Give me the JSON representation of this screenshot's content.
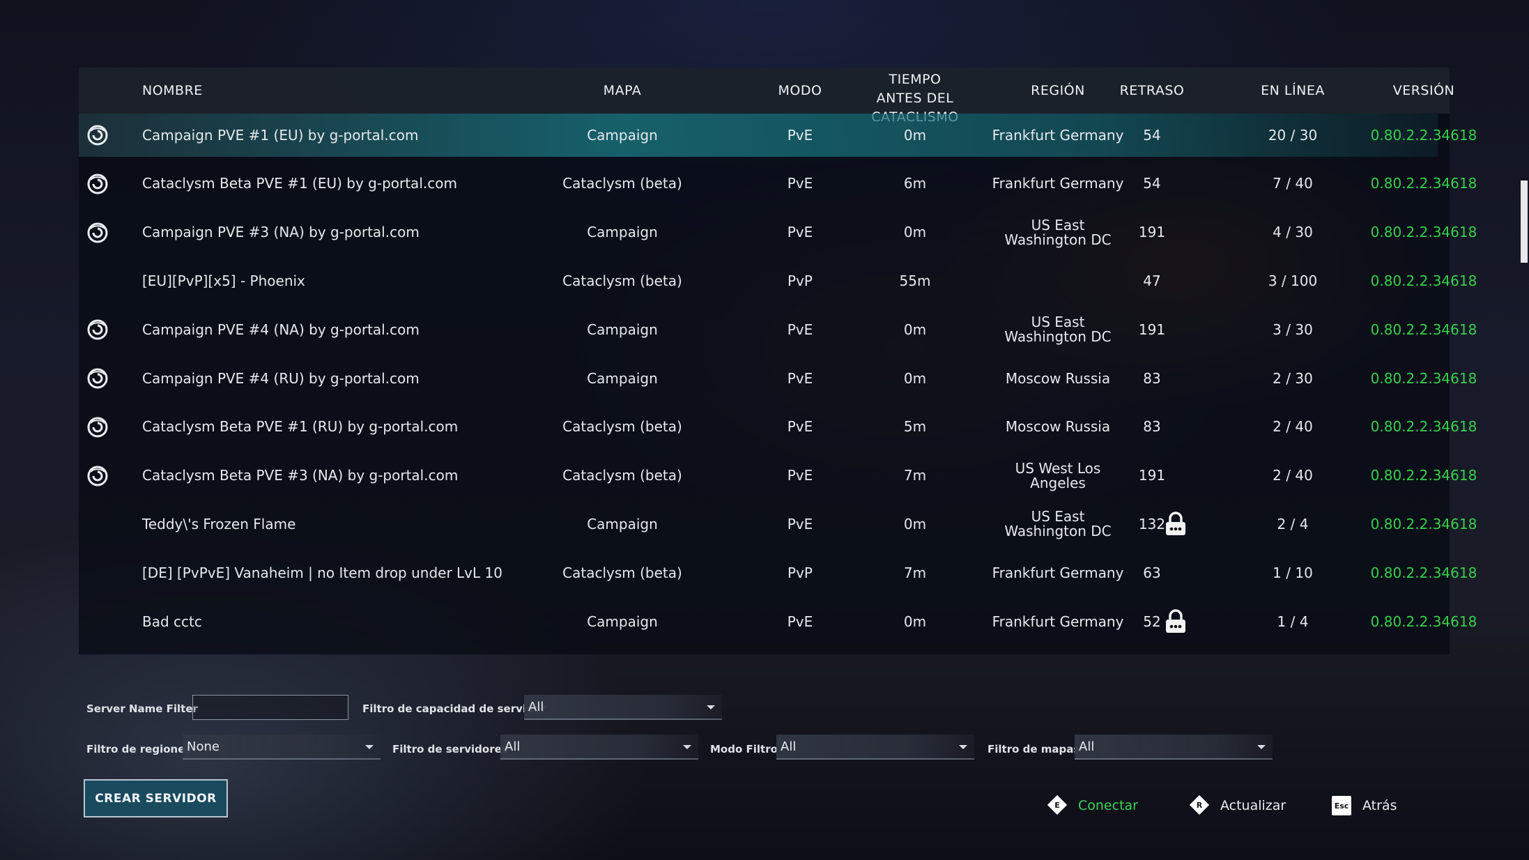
{
  "table": {
    "headers": {
      "name": "NOMBRE",
      "map": "MAPA",
      "mode": "MODO",
      "time_line1": "TIEMPO",
      "time_line2": "ANTES DEL",
      "time_line3": "CATACLISMO",
      "region": "REGIÓN",
      "ping": "RETRASO",
      "online": "EN LÍNEA",
      "version": "VERSIÓN"
    },
    "rows": [
      {
        "official": true,
        "name": "Campaign PVE #1 (EU) by g-portal.com",
        "map": "Campaign",
        "mode": "PvE",
        "time": "0m",
        "region_1": "Frankfurt Germany",
        "region_2": "",
        "ping": "54",
        "locked": false,
        "online": "20 / 30",
        "version": "0.80.2.2.34618"
      },
      {
        "official": true,
        "name": "Cataclysm Beta PVE #1 (EU) by g-portal.com",
        "map": "Cataclysm (beta)",
        "mode": "PvE",
        "time": "6m",
        "region_1": "Frankfurt Germany",
        "region_2": "",
        "ping": "54",
        "locked": false,
        "online": "7 / 40",
        "version": "0.80.2.2.34618"
      },
      {
        "official": true,
        "name": "Campaign PVE #3 (NA) by g-portal.com",
        "map": "Campaign",
        "mode": "PvE",
        "time": "0m",
        "region_1": "US East",
        "region_2": "Washington DC",
        "ping": "191",
        "locked": false,
        "online": "4 / 30",
        "version": "0.80.2.2.34618"
      },
      {
        "official": false,
        "name": "[EU][PvP][x5] - Phoenix",
        "map": "Cataclysm (beta)",
        "mode": "PvP",
        "time": "55m",
        "region_1": "",
        "region_2": "",
        "ping": "47",
        "locked": false,
        "online": "3 / 100",
        "version": "0.80.2.2.34618"
      },
      {
        "official": true,
        "name": "Campaign PVE #4 (NA) by g-portal.com",
        "map": "Campaign",
        "mode": "PvE",
        "time": "0m",
        "region_1": "US East",
        "region_2": "Washington DC",
        "ping": "191",
        "locked": false,
        "online": "3 / 30",
        "version": "0.80.2.2.34618"
      },
      {
        "official": true,
        "name": "Campaign PVE #4 (RU) by g-portal.com",
        "map": "Campaign",
        "mode": "PvE",
        "time": "0m",
        "region_1": "Moscow Russia",
        "region_2": "",
        "ping": "83",
        "locked": false,
        "online": "2 / 30",
        "version": "0.80.2.2.34618"
      },
      {
        "official": true,
        "name": "Cataclysm Beta PVE #1 (RU) by g-portal.com",
        "map": "Cataclysm (beta)",
        "mode": "PvE",
        "time": "5m",
        "region_1": "Moscow Russia",
        "region_2": "",
        "ping": "83",
        "locked": false,
        "online": "2 / 40",
        "version": "0.80.2.2.34618"
      },
      {
        "official": true,
        "name": "Cataclysm Beta PVE #3 (NA) by g-portal.com",
        "map": "Cataclysm (beta)",
        "mode": "PvE",
        "time": "7m",
        "region_1": "US West Los",
        "region_2": "Angeles",
        "ping": "191",
        "locked": false,
        "online": "2 / 40",
        "version": "0.80.2.2.34618"
      },
      {
        "official": false,
        "name": "Teddy\\'s Frozen Flame",
        "map": "Campaign",
        "mode": "PvE",
        "time": "0m",
        "region_1": "US East",
        "region_2": "Washington DC",
        "ping": "132",
        "locked": true,
        "online": "2 / 4",
        "version": "0.80.2.2.34618"
      },
      {
        "official": false,
        "name": "[DE] [PvPvE] Vanaheim | no Item drop under LvL 10",
        "map": "Cataclysm (beta)",
        "mode": "PvP",
        "time": "7m",
        "region_1": "Frankfurt Germany",
        "region_2": "",
        "ping": "63",
        "locked": false,
        "online": "1 / 10",
        "version": "0.80.2.2.34618"
      },
      {
        "official": false,
        "name": "Bad cctc",
        "map": "Campaign",
        "mode": "PvE",
        "time": "0m",
        "region_1": "Frankfurt Germany",
        "region_2": "",
        "ping": "52",
        "locked": true,
        "online": "1 / 4",
        "version": "0.80.2.2.34618"
      }
    ]
  },
  "filters": {
    "server_name_label": "Server Name Filter",
    "server_name_value": "",
    "capacity_label": "Filtro de capacidad de servidor",
    "capacity_value": "All",
    "regions_label": "Filtro de regiones",
    "regions_value": "None",
    "servers_label": "Filtro de servidores",
    "servers_value": "All",
    "mode_label": "Modo Filtro",
    "mode_value": "All",
    "maps_label": "Filtro de mapas",
    "maps_value": "All"
  },
  "actions": {
    "create_server": "CREAR SERVIDOR",
    "connect_key": "E",
    "connect": "Conectar",
    "refresh_key": "R",
    "refresh": "Actualizar",
    "back_key": "Esc",
    "back": "Atrás"
  },
  "colors": {
    "version_text": "#38d04a",
    "selected_row": "#186e78",
    "connect_text": "#3fd356"
  },
  "icons": {
    "official_server": "g-portal-logo-icon",
    "locked_server": "lock-icon"
  }
}
